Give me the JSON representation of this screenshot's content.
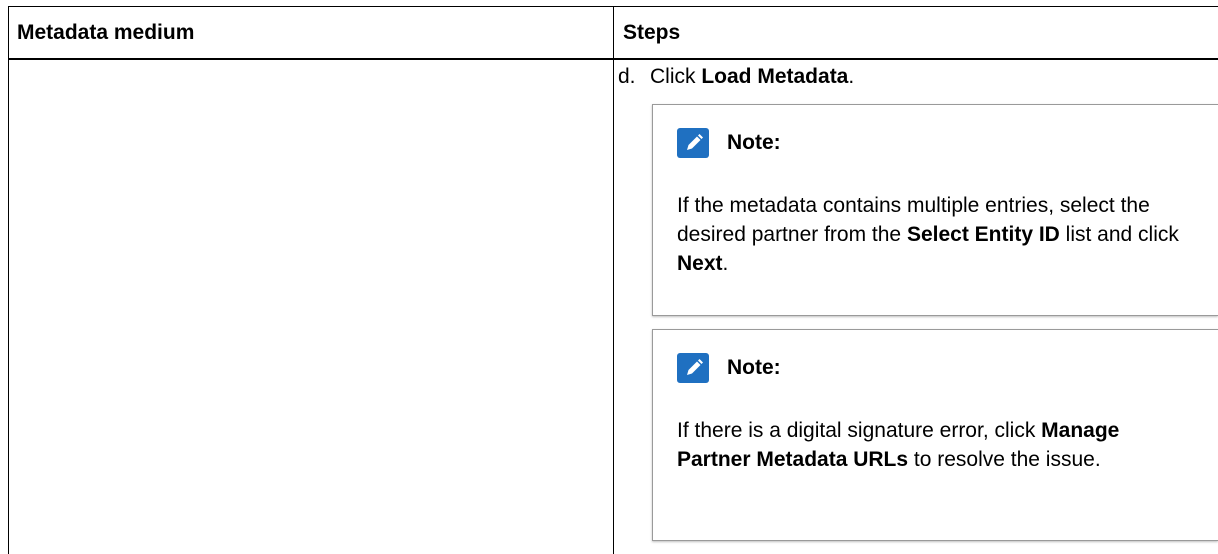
{
  "table": {
    "headers": [
      "Metadata medium",
      "Steps"
    ]
  },
  "step": {
    "marker": "d.",
    "text_before": "Click ",
    "bold": "Load Metadata",
    "text_after": "."
  },
  "notes": [
    {
      "title": "Note:",
      "icon": "pencil-note-icon",
      "parts": {
        "t1": "If the metadata contains multiple entries, select the desired partner from the ",
        "b1": "Select Entity ID",
        "t2": " list and click ",
        "b2": "Next",
        "t3": "."
      }
    },
    {
      "title": "Note:",
      "icon": "pencil-note-icon",
      "parts": {
        "t1": "If there is a digital signature error, click ",
        "b1": "Manage Partner Metadata URLs",
        "t2": " to resolve the issue."
      }
    }
  ],
  "colors": {
    "note_icon_bg": "#1f70c1",
    "border": "#000000",
    "note_border": "#9a9a9a"
  }
}
